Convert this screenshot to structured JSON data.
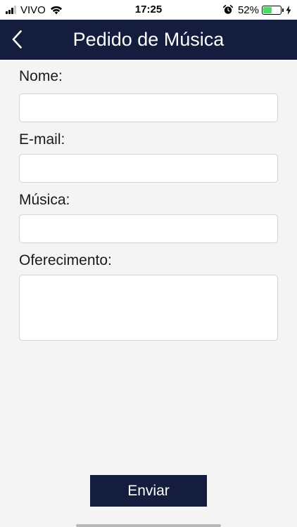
{
  "status_bar": {
    "carrier": "VIVO",
    "time": "17:25",
    "battery_percent": "52%",
    "battery_level": 0.52,
    "icons": [
      "signal-icon",
      "wifi-icon",
      "alarm-icon",
      "battery-icon",
      "charging-bolt-icon"
    ]
  },
  "nav": {
    "back_icon": "chevron-left-icon",
    "title": "Pedido de Música"
  },
  "form": {
    "name_label": "Nome:",
    "name_value": "",
    "email_label": "E-mail:",
    "email_value": "",
    "song_label": "Música:",
    "song_value": "",
    "dedication_label": "Oferecimento:",
    "dedication_value": ""
  },
  "submit": {
    "label": "Enviar"
  },
  "colors": {
    "nav_background": "#141d3d",
    "page_background": "#f4f4f4",
    "battery_fill": "#4cd964"
  }
}
